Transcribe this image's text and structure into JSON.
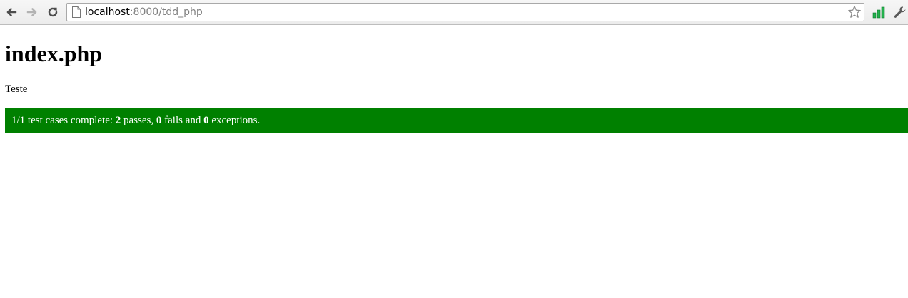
{
  "browser": {
    "url_host": "localhost",
    "url_rest": ":8000/tdd_php",
    "icons": {
      "back": "back-arrow-icon",
      "forward": "forward-arrow-icon",
      "reload": "reload-icon",
      "page": "page-icon",
      "star": "star-icon",
      "extension": "signal-bars-icon",
      "wrench": "wrench-icon"
    }
  },
  "page": {
    "heading": "index.php",
    "paragraph": "Teste"
  },
  "result": {
    "prefix": "1/1 test cases complete: ",
    "passes": "2",
    "passes_label": " passes, ",
    "fails": "0",
    "fails_label": " fails and ",
    "exceptions": "0",
    "exceptions_label": " exceptions.",
    "color": "#008000"
  }
}
